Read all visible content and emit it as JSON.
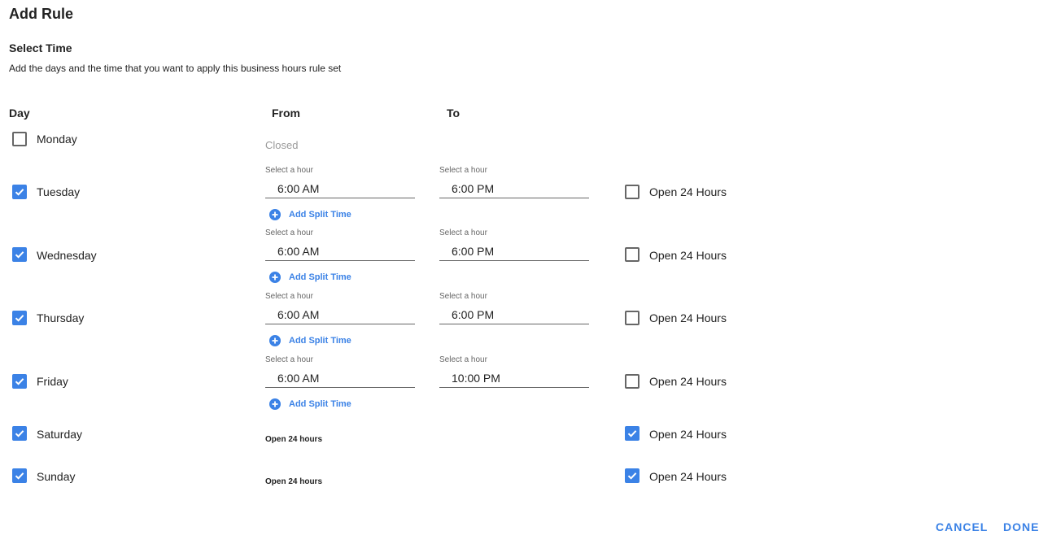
{
  "dialog": {
    "title": "Add Rule",
    "section_title": "Select Time",
    "description": "Add the days and the time that you want to apply this business hours rule set"
  },
  "headers": {
    "day": "Day",
    "from": "From",
    "to": "To"
  },
  "days": [
    {
      "label": "Monday",
      "checked": false,
      "state": "closed",
      "closed_label": "Closed"
    },
    {
      "label": "Tuesday",
      "checked": true,
      "state": "hours",
      "from_label": "Select a hour",
      "from": "6:00 AM",
      "to_label": "Select a hour",
      "to": "6:00 PM",
      "split_label": "Add Split Time",
      "open24_checked": false,
      "open24_label": "Open 24 Hours"
    },
    {
      "label": "Wednesday",
      "checked": true,
      "state": "hours",
      "from_label": "Select a hour",
      "from": "6:00 AM",
      "to_label": "Select a hour",
      "to": "6:00 PM",
      "split_label": "Add Split Time",
      "open24_checked": false,
      "open24_label": "Open 24 Hours"
    },
    {
      "label": "Thursday",
      "checked": true,
      "state": "hours",
      "from_label": "Select a hour",
      "from": "6:00 AM",
      "to_label": "Select a hour",
      "to": "6:00 PM",
      "split_label": "Add Split Time",
      "open24_checked": false,
      "open24_label": "Open 24 Hours"
    },
    {
      "label": "Friday",
      "checked": true,
      "state": "hours",
      "from_label": "Select a hour",
      "from": "6:00 AM",
      "to_label": "Select a hour",
      "to": "10:00 PM",
      "split_label": "Add Split Time",
      "open24_checked": false,
      "open24_label": "Open 24 Hours"
    },
    {
      "label": "Saturday",
      "checked": true,
      "state": "open24",
      "open24_text": "Open 24 hours",
      "open24_checked": true,
      "open24_label": "Open 24 Hours"
    },
    {
      "label": "Sunday",
      "checked": true,
      "state": "open24",
      "open24_text": "Open 24 hours",
      "open24_checked": true,
      "open24_label": "Open 24 Hours"
    }
  ],
  "actions": {
    "cancel": "CANCEL",
    "done": "DONE"
  },
  "colors": {
    "accent": "#3b82e6",
    "text": "#222222",
    "muted": "#9a9a9a"
  },
  "icons": {
    "checkbox_checked": "check-icon",
    "add_split": "plus-circle-icon"
  }
}
